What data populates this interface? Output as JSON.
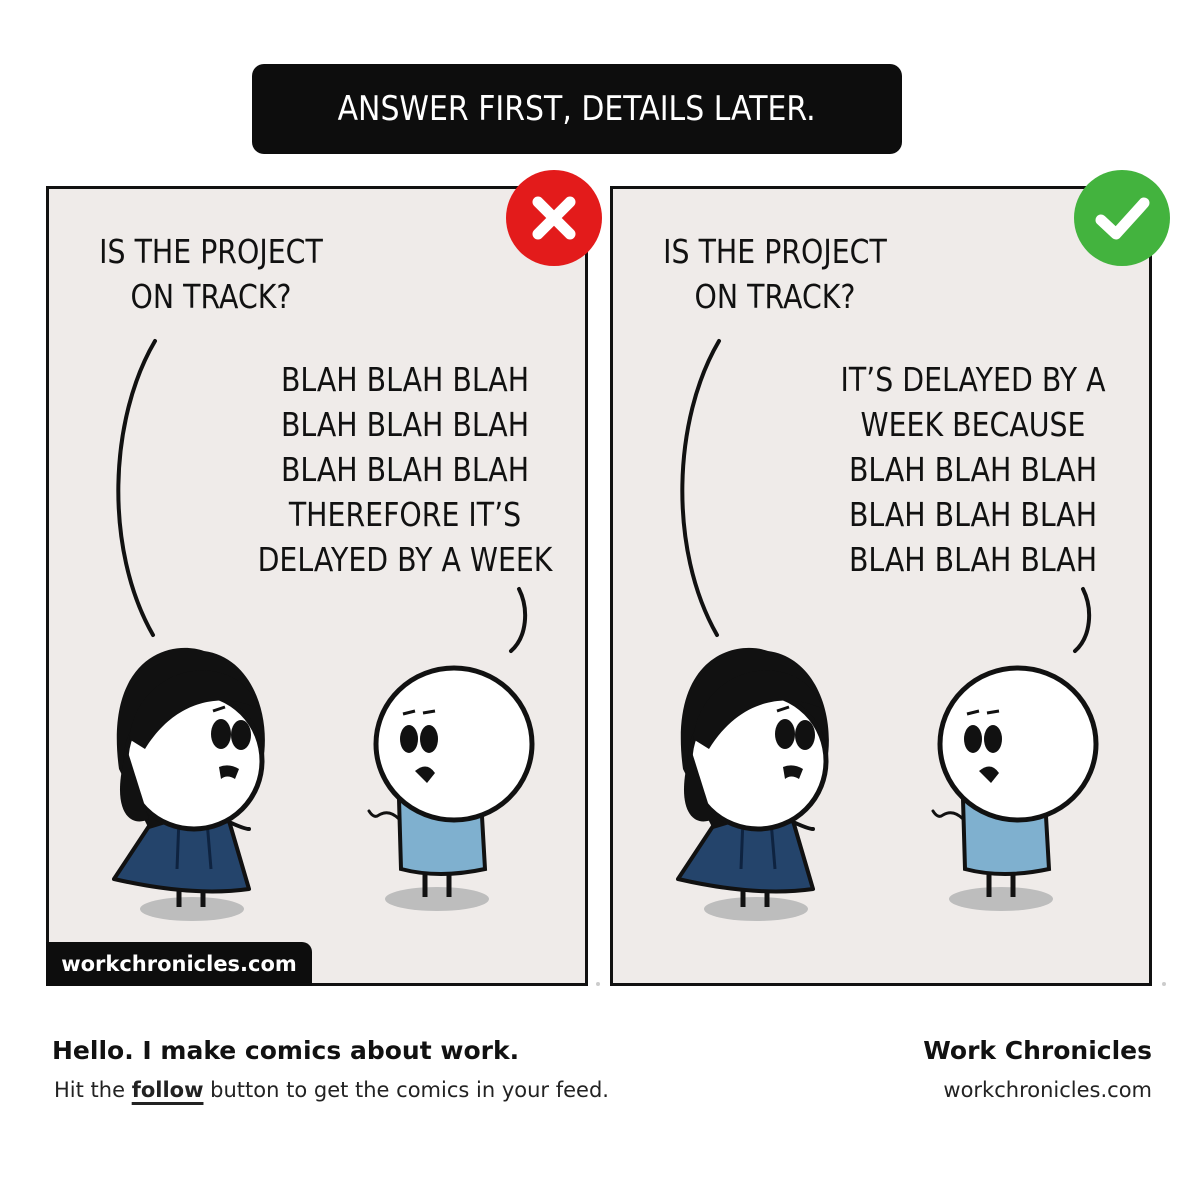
{
  "title": "ANSWER FIRST, DETAILS LATER.",
  "panels": [
    {
      "verdict": "wrong",
      "verdict_icon": "x-mark-icon",
      "question": "IS THE PROJECT\nON TRACK?",
      "answer": "BLAH BLAH BLAH\nBLAH BLAH BLAH\nBLAH BLAH BLAH\nTHEREFORE IT’S\nDELAYED BY A WEEK"
    },
    {
      "verdict": "right",
      "verdict_icon": "check-mark-icon",
      "question": "IS THE PROJECT\nON TRACK?",
      "answer": "IT’S DELAYED BY A\nWEEK BECAUSE\nBLAH BLAH BLAH\nBLAH BLAH BLAH\nBLAH BLAH BLAH"
    }
  ],
  "watermark": "workchronicles.com",
  "footer": {
    "headline": "Hello. I make comics about work.",
    "sub_prefix": "Hit the ",
    "sub_link": "follow",
    "sub_suffix": " button to get the comics in your feed.",
    "brand_name": "Work Chronicles",
    "brand_url": "workchronicles.com"
  },
  "colors": {
    "panel_bg": "#efebe9",
    "wrong": "#e31b1b",
    "right": "#43b33e",
    "dress": "#24446b",
    "shirt": "#7fb0cf",
    "tie": "#d8262b"
  }
}
